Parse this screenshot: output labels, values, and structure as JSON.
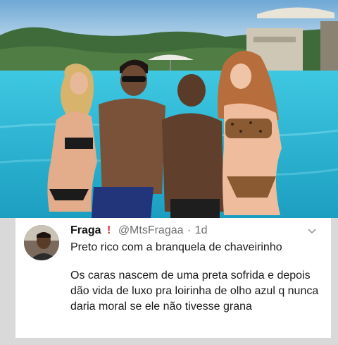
{
  "tweet": {
    "name": "Fraga",
    "badge_icon": "exclamation-icon",
    "handle": "@MtsFragaa",
    "separator": "·",
    "time": "1d",
    "line1": "Preto rico com a branquela de chaveirinho",
    "line2": "Os caras nascem de uma preta sofrida e depois dão vida de luxo pra loirinha de olho azul q nunca daria moral se ele não tivesse grana"
  },
  "photo": {
    "subject": "four people posing in front of a pool"
  },
  "colors": {
    "badge": "#d4312c",
    "muted": "#6e6e6e",
    "pool": "#2bb8d6"
  }
}
